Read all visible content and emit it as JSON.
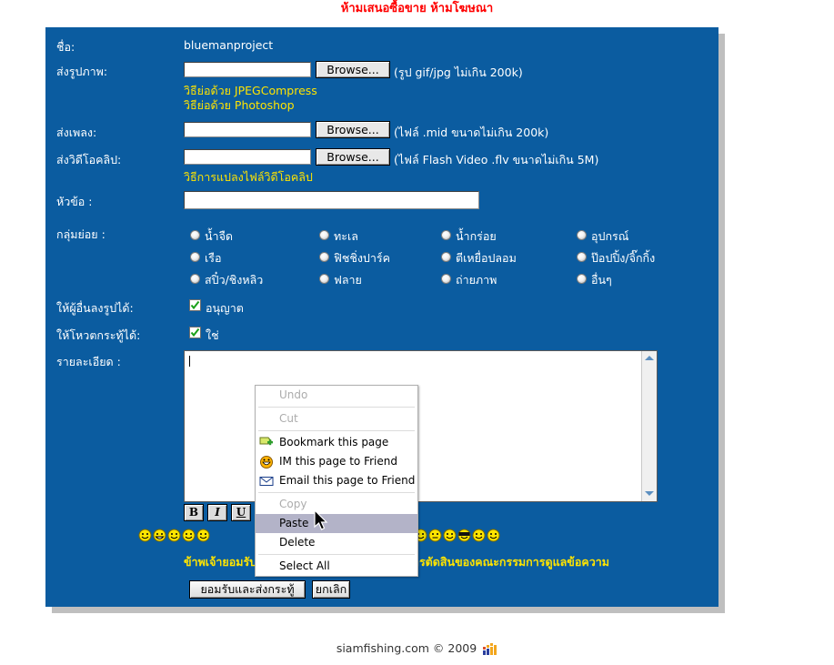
{
  "header": {
    "warning": "ห้ามเสนอซื้อขาย ห้ามโฆษณา",
    "warning_color": "#ff0000"
  },
  "theme": {
    "panel_bg": "#0b5ca0",
    "label_color": "#ffffff",
    "link_color": "#ffe400",
    "accent": "#0b5ca0"
  },
  "form": {
    "fields": [
      {
        "label": "ชื่อ:",
        "value": "bluemanproject",
        "type": "static"
      },
      {
        "label": "ส่งรูปภาพ:",
        "value": "",
        "type": "file",
        "button": "Browse...",
        "hint": "(รูป gif/jpg ไม่เกิน 200k)",
        "links": [
          "วิธีย่อด้วย JPEGCompress",
          "วิธีย่อด้วย Photoshop"
        ]
      },
      {
        "label": "ส่งเพลง:",
        "value": "",
        "type": "file",
        "button": "Browse...",
        "hint": "(ไฟล์ .mid ขนาดไม่เกิน 200k)",
        "links": []
      },
      {
        "label": "ส่งวิดีโอคลิป:",
        "value": "",
        "type": "file",
        "button": "Browse...",
        "hint": "(ไฟล์ Flash Video .flv ขนาดไม่เกิน 5M)",
        "links": [
          "วิธีการแปลงไฟล์วิดีโอคลิป"
        ]
      },
      {
        "label": "หัวข้อ :",
        "value": "",
        "type": "text"
      }
    ],
    "subgroup": {
      "label": "กลุ่มย่อย :",
      "options": [
        "น้ำจืด",
        "ทะเล",
        "น้ำกร่อย",
        "อุปกรณ์",
        "เรือ",
        "ฟิชชิ่งปาร์ค",
        "ตีเหยื่อปลอม",
        "ป๊อปปิ้ง/จิ๊กกิ้ง",
        "สปิ๋ว/ชิงหลิว",
        "ฟลาย",
        "ถ่ายภาพ",
        "อื่นๆ"
      ],
      "selected": ""
    },
    "checkboxes": [
      {
        "label": "ให้ผู้อื่นลงรูปได้:",
        "option": "อนุญาต",
        "checked": true
      },
      {
        "label": "ให้โหวตกระทู้ได้:",
        "option": "ใช่",
        "checked": true
      }
    ],
    "details": {
      "label": "รายละเอียด :",
      "value": "",
      "toolbar": [
        "B",
        "I",
        "U"
      ]
    },
    "disclaimer": "ข้าพเจ้ายอมรับเงื่อนไขทุกประการ และยอมรับการตัดสินของคณะกรรมการดูแลข้อความ",
    "buttons": {
      "submit": "ยอมรับและส่งกระทู้",
      "cancel": "ยกเลิก"
    }
  },
  "context_menu": {
    "items": [
      {
        "label": "Undo",
        "state": "disabled",
        "icon": ""
      },
      {
        "sep": true
      },
      {
        "label": "Cut",
        "state": "disabled",
        "icon": ""
      },
      {
        "sep": true
      },
      {
        "label": "Bookmark this page",
        "state": "normal",
        "icon": "bookmark-icon"
      },
      {
        "label": "IM this page to Friend",
        "state": "normal",
        "icon": "im-smiley-icon"
      },
      {
        "label": "Email this page to Friend",
        "state": "normal",
        "icon": "envelope-icon"
      },
      {
        "sep": true
      },
      {
        "label": "Copy",
        "state": "disabled",
        "icon": ""
      },
      {
        "label": "Paste",
        "state": "highlighted",
        "icon": ""
      },
      {
        "label": "Delete",
        "state": "normal",
        "icon": ""
      },
      {
        "sep": true
      },
      {
        "label": "Select All",
        "state": "normal",
        "icon": ""
      }
    ]
  },
  "footer": {
    "text": "siamfishing.com © 2009"
  }
}
